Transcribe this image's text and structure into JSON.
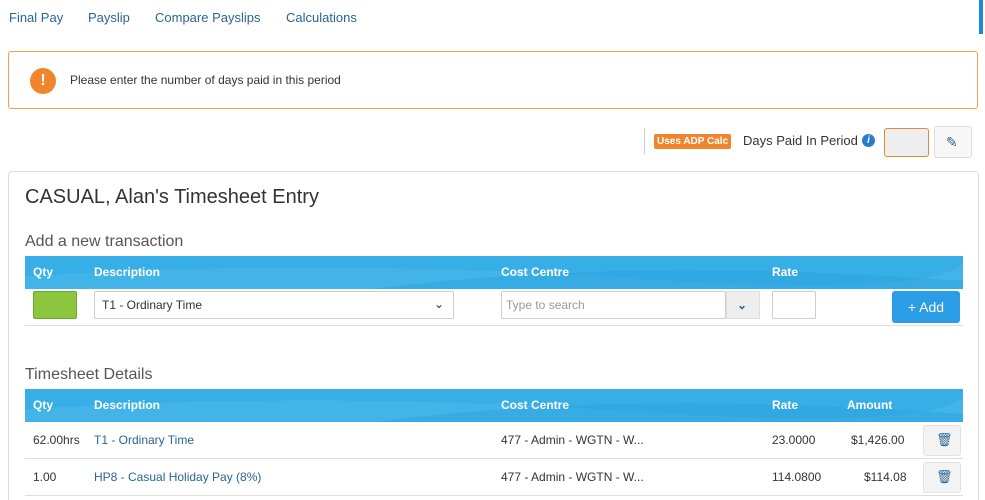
{
  "tabs": [
    "Final Pay",
    "Payslip",
    "Compare Payslips",
    "Calculations"
  ],
  "alert": {
    "icon": "!",
    "message": "Please enter the number of days paid in this period"
  },
  "days_paid": {
    "badge": "Uses ADP Calc",
    "label": "Days Paid In Period",
    "info_icon": "i",
    "value": ""
  },
  "panel": {
    "title": "CASUAL, Alan's Timesheet Entry"
  },
  "add_section": {
    "title": "Add a new transaction",
    "columns": [
      "Qty",
      "Description",
      "Cost Centre",
      "Rate"
    ],
    "qty_value": "",
    "description_selected": "T1 - Ordinary Time",
    "cost_centre_placeholder": "Type to search",
    "rate_value": "",
    "add_label": "+ Add",
    "qty_color": "#8cc63f"
  },
  "details_section": {
    "title": "Timesheet Details",
    "columns": [
      "Qty",
      "Description",
      "Cost Centre",
      "Rate",
      "Amount"
    ],
    "rows": [
      {
        "qty": "62.00hrs",
        "description": "T1 - Ordinary Time",
        "cost_centre": "477 - Admin - WGTN - W...",
        "rate": "23.0000",
        "amount": "$1,426.00"
      },
      {
        "qty": "1.00",
        "description": "HP8 - Casual Holiday Pay (8%)",
        "cost_centre": "477 - Admin - WGTN - W...",
        "rate": "114.0800",
        "amount": "$114.08"
      }
    ]
  },
  "colors": {
    "header_blue": "#38aee6",
    "accent_orange": "#f0852d",
    "link_blue": "#2a6496",
    "button_blue": "#2a9de6"
  },
  "icons": {
    "alert": "exclamation-circle-icon",
    "info": "info-circle-icon",
    "edit": "pencil-icon",
    "dropdown": "chevron-down-icon",
    "delete": "trash-icon"
  }
}
